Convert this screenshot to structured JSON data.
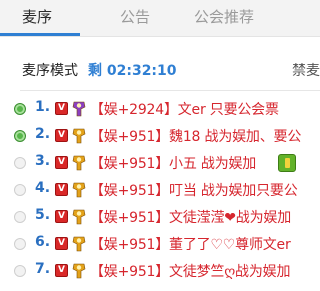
{
  "tabs": [
    {
      "label": "麦序"
    },
    {
      "label": "公告"
    },
    {
      "label": "公会推荐"
    }
  ],
  "mode": {
    "label": "麦序模式",
    "countdown": "剩 02:32:10",
    "forbid_label": "禁麦"
  },
  "rows": [
    {
      "number": "1.",
      "selected": true,
      "badge": "V",
      "rank_color": "#8a3fc1",
      "text_a": "【娱+2924】文er   只要公会票",
      "text_b": "",
      "gift": false
    },
    {
      "number": "2.",
      "selected": true,
      "badge": "V",
      "rank_color": "#e3a21a",
      "text_a": "【娱+951】魏18 战为娱加、要公",
      "text_b": "",
      "gift": false
    },
    {
      "number": "3.",
      "selected": false,
      "badge": "V",
      "rank_color": "#e3a21a",
      "text_a": "【娱+951】小五  战为娱加",
      "text_b": "",
      "gift": true
    },
    {
      "number": "4.",
      "selected": false,
      "badge": "V",
      "rank_color": "#e3a21a",
      "text_a": "【娱+951】叮当 战为娱加只要公",
      "text_b": "",
      "gift": false
    },
    {
      "number": "5.",
      "selected": false,
      "badge": "V",
      "rank_color": "#e3a21a",
      "text_a": "【娱+951】文徒滢滢",
      "heart": "❤",
      "text_b": "战为娱加",
      "gift": false
    },
    {
      "number": "6.",
      "selected": false,
      "badge": "V",
      "rank_color": "#e3a21a",
      "text_a": "【娱+951】董了了♡♡尊师文er",
      "text_b": "",
      "gift": false
    },
    {
      "number": "7.",
      "selected": false,
      "badge": "V",
      "rank_color": "#e3a21a",
      "text_a": "【娱+951】文徒梦竺ღ战为娱加",
      "text_b": "",
      "gift": false
    }
  ]
}
